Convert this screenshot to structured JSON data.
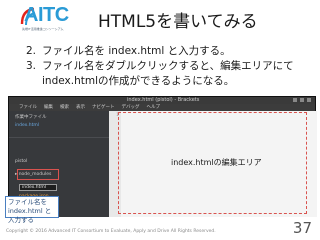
{
  "logo": {
    "text": "AITC",
    "subtitle": "先端IT活用推進コンソーシアム"
  },
  "title": "HTML5を書いてみる",
  "steps": [
    {
      "num": "2.",
      "text": "ファイル名を index.html と入力する。"
    },
    {
      "num": "3.",
      "text": "ファイル名をダブルクリックすると、編集エリアにてindex.htmlの作成ができるようになる。"
    }
  ],
  "screenshot": {
    "window_title": "index.html (pistol) - Brackets",
    "menu": [
      "ファイル",
      "編集",
      "検索",
      "表示",
      "ナビゲート",
      "デバッグ",
      "ヘルプ"
    ],
    "sidebar": {
      "working_files": "作業中ファイル",
      "working_file": "index.html",
      "project": "pistol",
      "folder": "▸ node_modules",
      "new_file_value": "index.html",
      "package": "package.json"
    },
    "line_number": "1"
  },
  "editor_label": "index.htmlの編集エリア",
  "callout": "ファイル名を index.html と入力する",
  "footer": "Copyright © 2016 Advanced IT Consortium to Evaluate, Apply and Drive All Rights Reserved.",
  "page_number": "37",
  "colors": {
    "accent": "#2a9bd6",
    "highlight": "#d9534f"
  }
}
